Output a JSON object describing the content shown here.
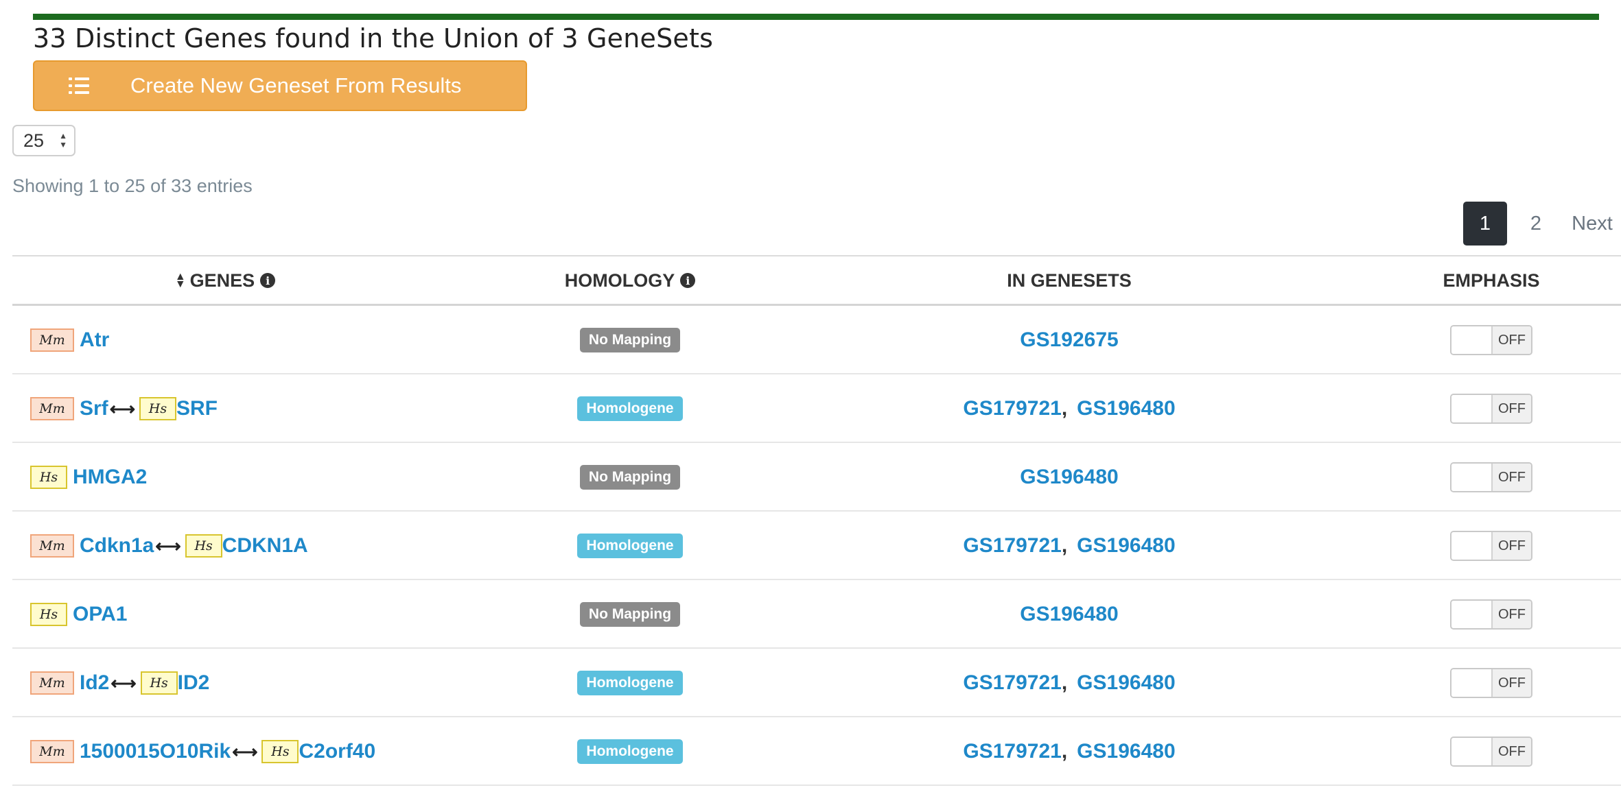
{
  "header": {
    "title": "33 Distinct Genes found in the Union of 3 GeneSets",
    "create_button_label": "Create New Geneset From Results",
    "accent_color": "#1c6b1f",
    "button_color": "#f0ad54"
  },
  "controls": {
    "page_length": "25",
    "showing_text": "Showing 1 to 25 of 33 entries",
    "pagination": {
      "current": "1",
      "page2": "2",
      "next": "Next"
    }
  },
  "table": {
    "columns": [
      "GENES",
      "HOMOLOGY",
      "IN GENESETS",
      "EMPHASIS"
    ],
    "rows": [
      {
        "species1": "Mm",
        "gene1": "Atr",
        "species2": "",
        "gene2": "",
        "homology": "No Mapping",
        "genesets": [
          "GS192675"
        ],
        "emphasis": "OFF"
      },
      {
        "species1": "Mm",
        "gene1": "Srf",
        "species2": "Hs",
        "gene2": "SRF",
        "homology": "Homologene",
        "genesets": [
          "GS179721",
          "GS196480"
        ],
        "emphasis": "OFF"
      },
      {
        "species1": "Hs",
        "gene1": "HMGA2",
        "species2": "",
        "gene2": "",
        "homology": "No Mapping",
        "genesets": [
          "GS196480"
        ],
        "emphasis": "OFF"
      },
      {
        "species1": "Mm",
        "gene1": "Cdkn1a",
        "species2": "Hs",
        "gene2": "CDKN1A",
        "homology": "Homologene",
        "genesets": [
          "GS179721",
          "GS196480"
        ],
        "emphasis": "OFF"
      },
      {
        "species1": "Hs",
        "gene1": "OPA1",
        "species2": "",
        "gene2": "",
        "homology": "No Mapping",
        "genesets": [
          "GS196480"
        ],
        "emphasis": "OFF"
      },
      {
        "species1": "Mm",
        "gene1": "Id2",
        "species2": "Hs",
        "gene2": "ID2",
        "homology": "Homologene",
        "genesets": [
          "GS179721",
          "GS196480"
        ],
        "emphasis": "OFF"
      },
      {
        "species1": "Mm",
        "gene1": "1500015O10Rik",
        "species2": "Hs",
        "gene2": "C2orf40",
        "homology": "Homologene",
        "genesets": [
          "GS179721",
          "GS196480"
        ],
        "emphasis": "OFF"
      }
    ]
  }
}
